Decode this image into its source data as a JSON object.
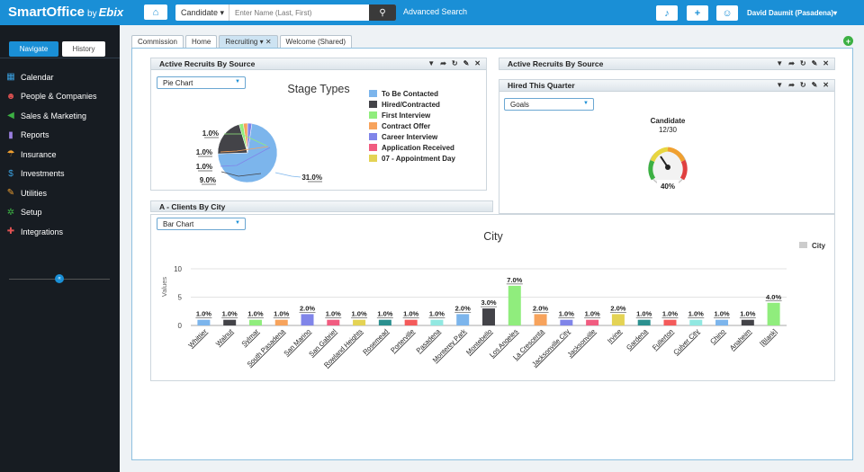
{
  "app": {
    "brand": "SmartOffice",
    "by": "by",
    "partner": "Ebix"
  },
  "search": {
    "type": "Candidate ▾",
    "placeholder": "Enter Name (Last, First)",
    "advanced": "Advanced Search"
  },
  "user": {
    "name": "David Daumit (Pasadena)▾"
  },
  "nav": {
    "tabs": [
      "Navigate",
      "History"
    ],
    "items": [
      {
        "label": "Calendar",
        "icon": "calendar-icon",
        "color": "#3aa0e0",
        "glyph": "▦"
      },
      {
        "label": "People & Companies",
        "icon": "people-icon",
        "color": "#e05252",
        "glyph": "☻"
      },
      {
        "label": "Sales & Marketing",
        "icon": "megaphone-icon",
        "color": "#3cb043",
        "glyph": "◀"
      },
      {
        "label": "Reports",
        "icon": "bar-chart-icon",
        "color": "#9b7fe0",
        "glyph": "▮"
      },
      {
        "label": "Insurance",
        "icon": "umbrella-icon",
        "color": "#f0a030",
        "glyph": "☂"
      },
      {
        "label": "Investments",
        "icon": "dollar-icon",
        "color": "#3aa0e0",
        "glyph": "$"
      },
      {
        "label": "Utilities",
        "icon": "wrench-icon",
        "color": "#f0a030",
        "glyph": "✎"
      },
      {
        "label": "Setup",
        "icon": "gears-icon",
        "color": "#3cb043",
        "glyph": "✲"
      },
      {
        "label": "Integrations",
        "icon": "puzzle-icon",
        "color": "#e05252",
        "glyph": "✚"
      }
    ]
  },
  "tabs": [
    {
      "label": "Commission",
      "active": false
    },
    {
      "label": "Home",
      "active": false
    },
    {
      "label": "Recruiting ▾ ✕",
      "active": true
    },
    {
      "label": "Welcome (Shared)",
      "active": false
    }
  ],
  "panels": {
    "recruits": {
      "title": "Active Recruits By Source",
      "dropdown": "Pie Chart",
      "chart_title": "Stage Types"
    },
    "recruits2": {
      "title": "Active Recruits By Source"
    },
    "hired": {
      "title": "Hired This Quarter",
      "dropdown": "Goals",
      "label": "Candidate",
      "value": "12/30",
      "percent": "40%"
    },
    "clients": {
      "title": "A - Clients By City",
      "dropdown": "Bar Chart",
      "chart_title": "City",
      "legend": "City",
      "ylabel": "Values"
    }
  },
  "chart_data": [
    {
      "type": "pie",
      "title": "Stage Types",
      "legend": [
        {
          "label": "To Be Contacted",
          "color": "#7cb5ec"
        },
        {
          "label": "Hired/Contracted",
          "color": "#434348"
        },
        {
          "label": "First Interview",
          "color": "#90ed7d"
        },
        {
          "label": "Contract Offer",
          "color": "#f7a35c"
        },
        {
          "label": "Career Interview",
          "color": "#8085e9"
        },
        {
          "label": "Application Received",
          "color": "#f15c80"
        },
        {
          "label": "07 - Appointment Day",
          "color": "#e4d354"
        }
      ],
      "slices": [
        31.0,
        9.0,
        1.0,
        1.0,
        1.0
      ],
      "labels": [
        "31.0%",
        "9.0%",
        "1.0%",
        "1.0%",
        "1.0%"
      ]
    },
    {
      "type": "bar",
      "title": "City",
      "ylabel": "Values",
      "ylim": [
        0,
        10
      ],
      "yticks": [
        0,
        5,
        10
      ],
      "categories": [
        "Whittier",
        "Walnut",
        "Sylmar",
        "South Pasadena",
        "San Marino",
        "San Gabriel",
        "Rowland Heights",
        "Rosemead",
        "Porterville",
        "Pasadena",
        "Monterey Park",
        "Montebello",
        "Los Angeles",
        "La Crescenta",
        "Jacksonville City",
        "Jacksonville",
        "Irvine",
        "Gardena",
        "Fullerton",
        "Culver City",
        "Chino",
        "Anaheim",
        "[Blank]"
      ],
      "values": [
        1,
        1,
        1,
        1,
        2,
        1,
        1,
        1,
        1,
        1,
        2,
        3,
        7,
        2,
        1,
        1,
        2,
        1,
        1,
        1,
        1,
        1,
        4
      ],
      "labels": [
        "1.0%",
        "1.0%",
        "1.0%",
        "1.0%",
        "2.0%",
        "1.0%",
        "1.0%",
        "1.0%",
        "1.0%",
        "1.0%",
        "2.0%",
        "3.0%",
        "7.0%",
        "2.0%",
        "1.0%",
        "1.0%",
        "2.0%",
        "1.0%",
        "1.0%",
        "1.0%",
        "1.0%",
        "1.0%",
        "4.0%"
      ],
      "colors": [
        "#7cb5ec",
        "#434348",
        "#90ed7d",
        "#f7a35c",
        "#8085e9",
        "#f15c80",
        "#e4d354",
        "#2b908f",
        "#f45b5b",
        "#91e8e1",
        "#7cb5ec",
        "#434348",
        "#90ed7d",
        "#f7a35c",
        "#8085e9",
        "#f15c80",
        "#e4d354",
        "#2b908f",
        "#f45b5b",
        "#91e8e1",
        "#7cb5ec",
        "#434348",
        "#90ed7d"
      ]
    }
  ]
}
